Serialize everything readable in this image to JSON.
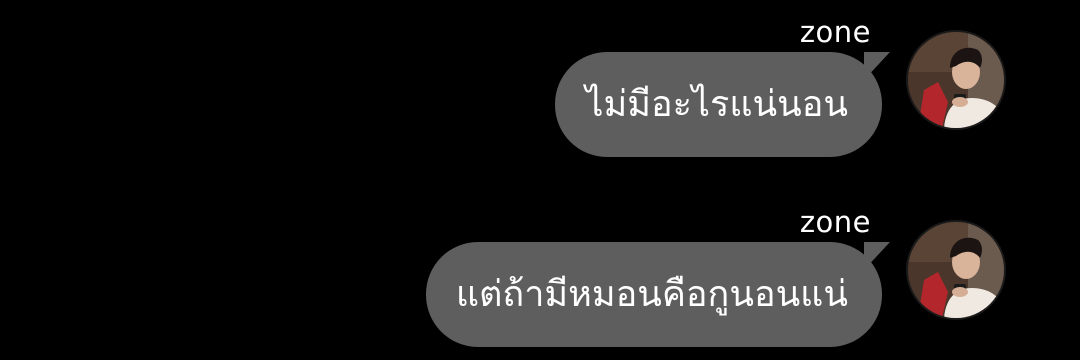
{
  "messages": [
    {
      "sender": "zone",
      "text": "ไม่มีอะไรแน่นอน",
      "avatar": "profile-photo"
    },
    {
      "sender": "zone",
      "text": "แต่ถ้ามีหมอนคือกูนอนแน่",
      "avatar": "profile-photo"
    }
  ],
  "colors": {
    "background": "#000000",
    "bubble": "#5e5e5e",
    "text": "#ffffff"
  }
}
